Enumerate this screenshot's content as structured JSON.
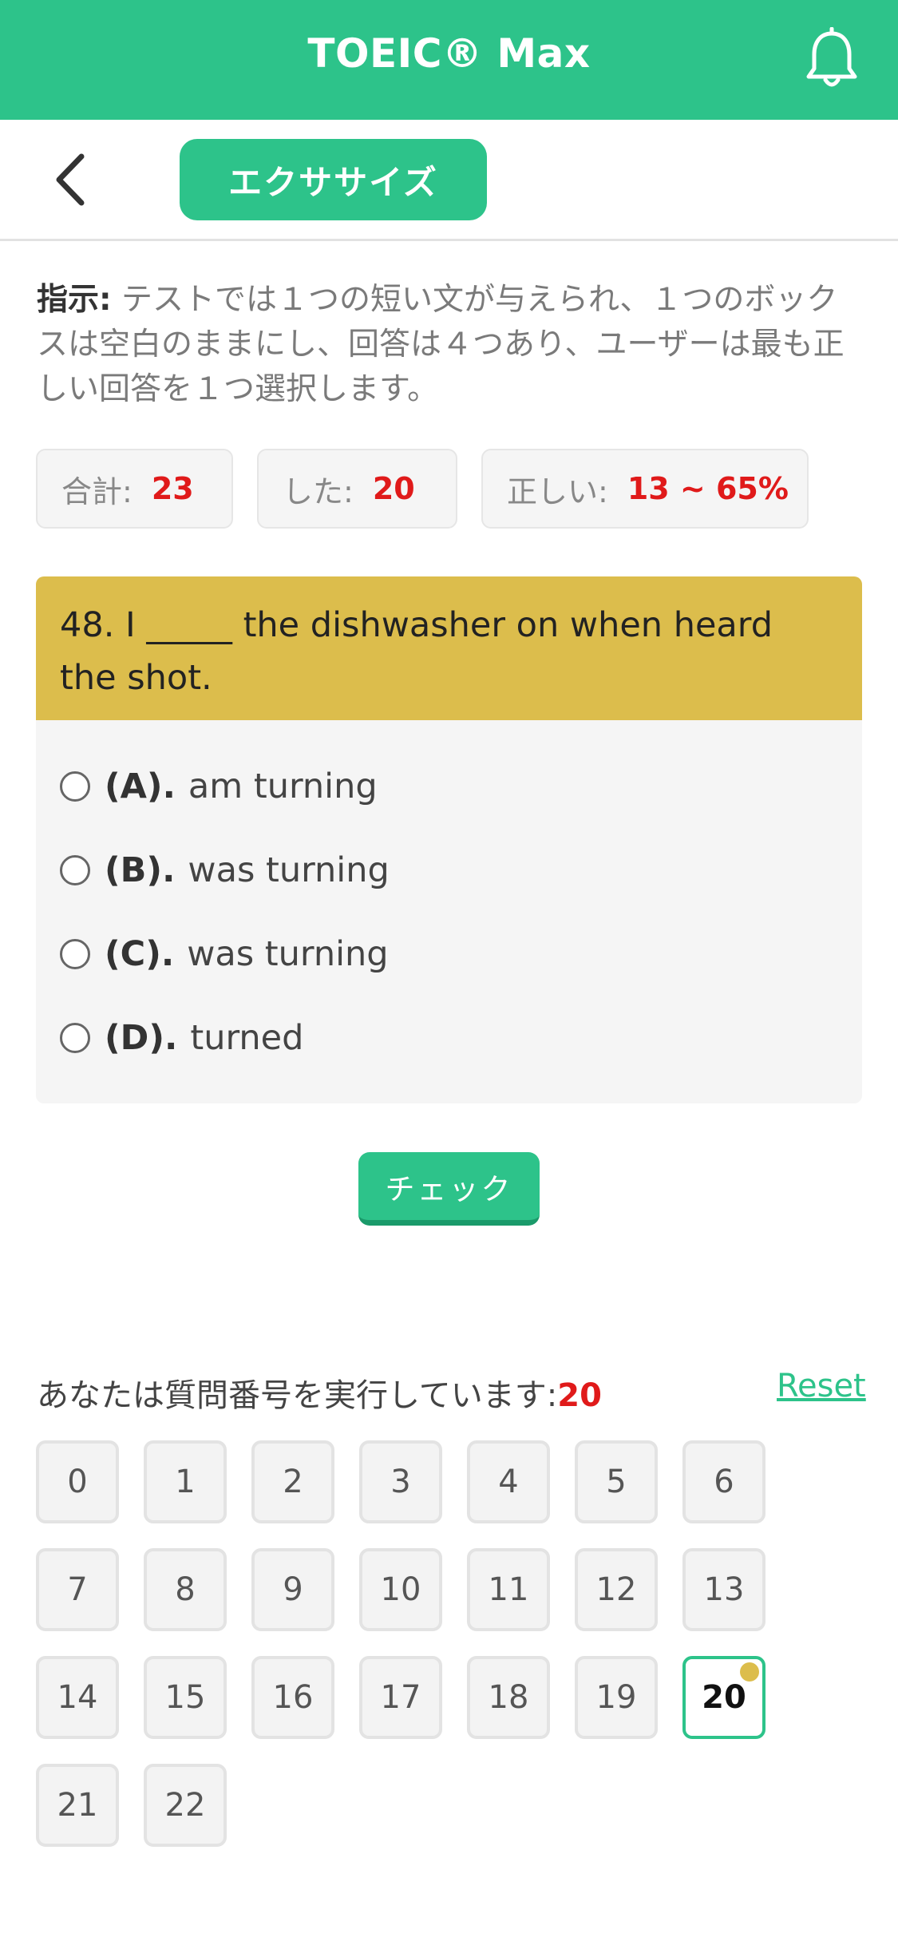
{
  "header": {
    "title": "TOEIC® Max",
    "bell_icon": "bell-icon"
  },
  "subbar": {
    "back_icon": "chevron-left-icon",
    "tab_label": "エクササイズ"
  },
  "instruction": {
    "label": "指示:",
    "text": " テストでは１つの短い文が与えられ、１つのボックスは空白のままにし、回答は４つあり、ユーザーは最も正しい回答を１つ選択します。"
  },
  "stats": [
    {
      "label": "合計:",
      "value": "23"
    },
    {
      "label": "した:",
      "value": "20"
    },
    {
      "label": "正しい:",
      "value": "13 ~ 65%"
    }
  ],
  "question": {
    "text": "48. I _____ the dishwasher on when heard the shot.",
    "options": [
      {
        "letter": "(A).",
        "text": "am turning"
      },
      {
        "letter": "(B).",
        "text": "was turning"
      },
      {
        "letter": "(C).",
        "text": "was turning"
      },
      {
        "letter": "(D).",
        "text": "turned"
      }
    ]
  },
  "check_label": "チェック",
  "progress": {
    "label": "あなたは質問番号を実行しています:",
    "current": "20",
    "reset_label": "Reset"
  },
  "numbers": [
    "0",
    "1",
    "2",
    "3",
    "4",
    "5",
    "6",
    "7",
    "8",
    "9",
    "10",
    "11",
    "12",
    "13",
    "14",
    "15",
    "16",
    "17",
    "18",
    "19",
    "20",
    "21",
    "22"
  ],
  "colors": {
    "primary": "#2dc38a",
    "question_header": "#dcbd4c",
    "highlight_red": "#e01a1a"
  }
}
